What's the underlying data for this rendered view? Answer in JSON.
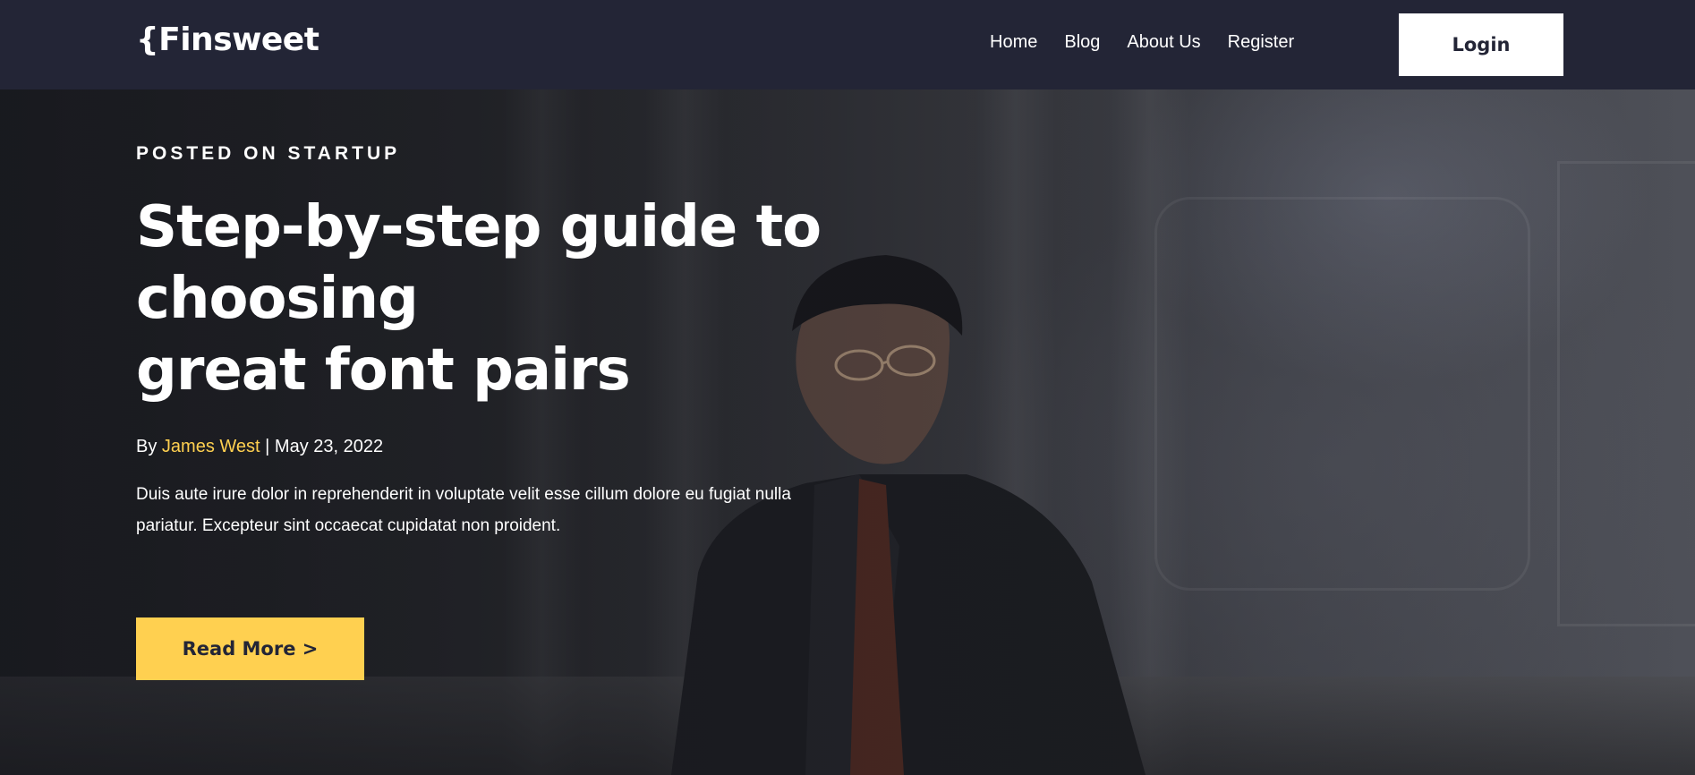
{
  "brand": {
    "logo": "{Finsweet"
  },
  "nav": {
    "links": [
      {
        "label": "Home"
      },
      {
        "label": "Blog"
      },
      {
        "label": "About Us"
      },
      {
        "label": "Register"
      }
    ],
    "login_label": "Login"
  },
  "hero": {
    "eyebrow": "POSTED ON STARTUP",
    "headline_line1": "Step-by-step guide to choosing",
    "headline_line2": "great font pairs",
    "byline_prefix": "By",
    "author": "James West",
    "separator": "|",
    "date": "May 23, 2022",
    "excerpt": "Duis aute irure dolor in reprehenderit in voluptate velit esse cillum dolore eu fugiat nulla pariatur. Excepteur sint occaecat cupidatat non proident.",
    "cta_label": "Read More >"
  },
  "colors": {
    "navbar_bg": "#232536",
    "accent": "#ffd050",
    "text": "#ffffff",
    "button_text": "#232536"
  }
}
